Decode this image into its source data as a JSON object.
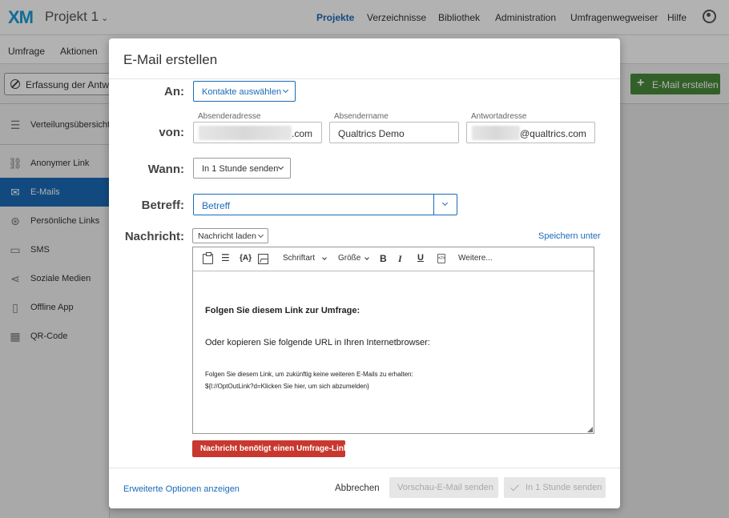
{
  "app": {
    "logo": "XM",
    "project": "Projekt 1",
    "nav": [
      "Projekte",
      "Verzeichnisse",
      "Bibliothek",
      "Administration",
      "Umfragenwegweiser",
      "Hilfe"
    ],
    "active_nav": "Projekte"
  },
  "subnav": [
    "Umfrage",
    "Aktionen"
  ],
  "filter": {
    "label": "Erfassung der Antworten"
  },
  "new_email_button": "E-Mail erstellen",
  "sidebar": {
    "items": [
      {
        "label": "Verteilungsübersicht",
        "icon": "list-icon"
      },
      {
        "label": "Anonymer Link",
        "icon": "link-icon"
      },
      {
        "label": "E-Mails",
        "icon": "envelope-icon",
        "active": true
      },
      {
        "label": "Persönliche Links",
        "icon": "fingerprint-icon"
      },
      {
        "label": "SMS",
        "icon": "chat-icon"
      },
      {
        "label": "Soziale Medien",
        "icon": "share-icon"
      },
      {
        "label": "Offline App",
        "icon": "tablet-icon"
      },
      {
        "label": "QR-Code",
        "icon": "qr-icon"
      }
    ]
  },
  "modal": {
    "title": "E-Mail erstellen",
    "to": {
      "label": "An:",
      "button": "Kontakte auswählen"
    },
    "from": {
      "label": "von:",
      "sender_caption": "Absenderadresse",
      "sender_suffix": ".com",
      "name_caption": "Absendername",
      "name_value": "Qualtrics Demo",
      "reply_caption": "Antwortadresse",
      "reply_suffix": "@qualtrics.com"
    },
    "when": {
      "label": "Wann:",
      "value": "In 1 Stunde senden"
    },
    "subject": {
      "label": "Betreff:",
      "value": "Betreff"
    },
    "message": {
      "label": "Nachricht:",
      "load_button": "Nachricht laden",
      "save_link": "Speichern unter",
      "toolbar": {
        "font": "Schriftart",
        "size": "Größe",
        "bold": "B",
        "italic": "I",
        "underline": "U",
        "more": "Weitere..."
      },
      "body": {
        "heading": "Folgen Sie diesem Link zur Umfrage:",
        "line": "Oder kopieren Sie folgende URL in Ihren Internetbrowser:",
        "optout1": "Folgen Sie diesem Link, um zukünftig keine weiteren E-Mails zu erhalten:",
        "optout2": "${l://OptOutLink?d=Klicken Sie hier, um sich abzumelden}"
      }
    },
    "error": "Nachricht benötigt einen Umfrage-Link",
    "footer": {
      "advanced": "Erweiterte Optionen anzeigen",
      "cancel": "Abbrechen",
      "preview": "Vorschau-E-Mail senden",
      "send": "In 1 Stunde senden"
    }
  }
}
